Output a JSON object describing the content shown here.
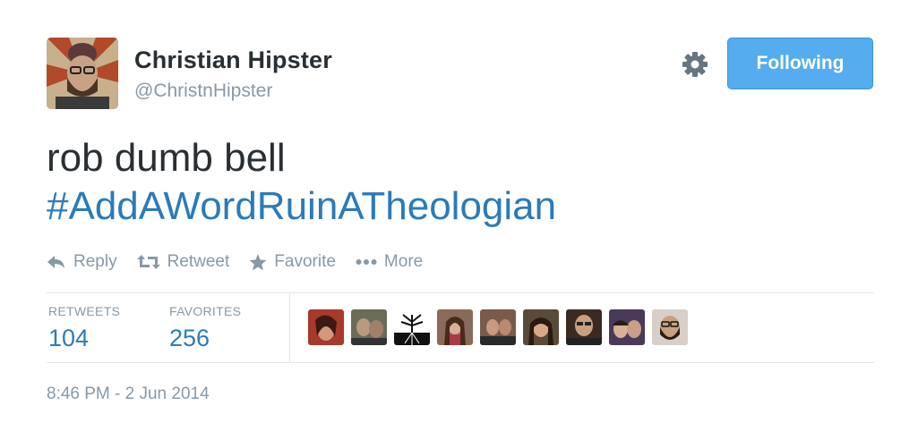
{
  "author": {
    "name": "Christian Hipster",
    "handle": "@ChristnHipster",
    "avatar_icon": "profile-avatar"
  },
  "header": {
    "settings_icon": "gear-icon",
    "follow_label": "Following",
    "follow_color": "#55acee"
  },
  "tweet": {
    "text": "rob dumb bell",
    "hashtag": "#AddAWordRuinATheologian",
    "hashtag_color": "#2b7bb9"
  },
  "actions": [
    {
      "label": "Reply",
      "icon": "reply-icon"
    },
    {
      "label": "Retweet",
      "icon": "retweet-icon"
    },
    {
      "label": "Favorite",
      "icon": "star-icon"
    },
    {
      "label": "More",
      "icon": "more-icon"
    }
  ],
  "stats": {
    "retweets_label": "RETWEETS",
    "retweets_count": "104",
    "favorites_label": "FAVORITES",
    "favorites_count": "256"
  },
  "timestamp": "8:46 PM - 2 Jun 2014"
}
